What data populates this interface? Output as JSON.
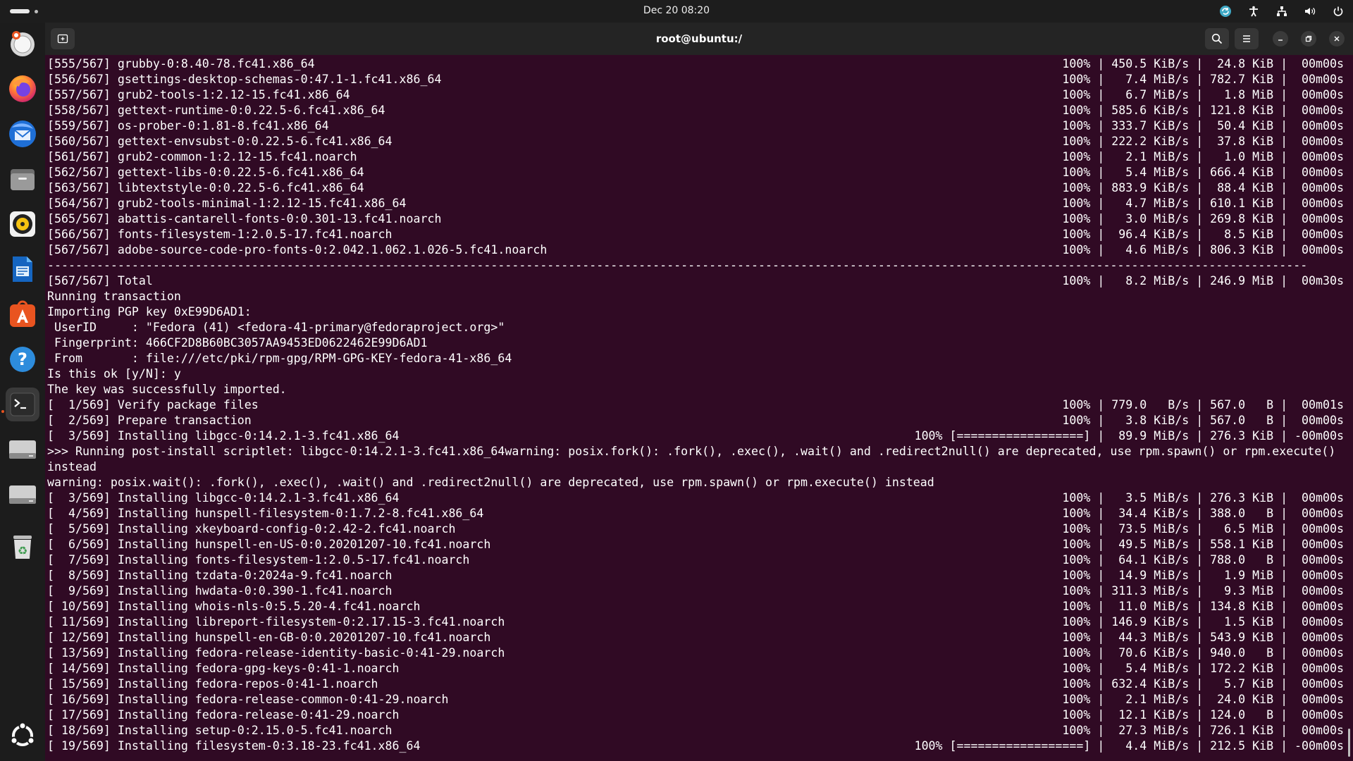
{
  "topbar": {
    "clock": "Dec 20  08:20",
    "tray_icons": [
      "updates-icon",
      "accessibility-icon",
      "network-icon",
      "volume-icon",
      "power-icon"
    ]
  },
  "dock": {
    "items": [
      "ubuntu-desktop-icon",
      "firefox-icon",
      "thunderbird-icon",
      "files-icon",
      "rhythmbox-icon",
      "writer-icon",
      "app-center-icon",
      "help-icon",
      "terminal-icon",
      "drive-icon",
      "drive-icon",
      "trash-icon"
    ],
    "show_apps": "show-apps-icon"
  },
  "window": {
    "title": "root@ubuntu:/",
    "bg": "#300a24"
  },
  "terminal": {
    "lines": [
      {
        "l": "[555/567] grubby-0:8.40-78.fc41.x86_64",
        "r": "100% | 450.5 KiB/s |  24.8 KiB |  00m00s"
      },
      {
        "l": "[556/567] gsettings-desktop-schemas-0:47.1-1.fc41.x86_64",
        "r": "100% |   7.4 MiB/s | 782.7 KiB |  00m00s"
      },
      {
        "l": "[557/567] grub2-tools-1:2.12-15.fc41.x86_64",
        "r": "100% |   6.7 MiB/s |   1.8 MiB |  00m00s"
      },
      {
        "l": "[558/567] gettext-runtime-0:0.22.5-6.fc41.x86_64",
        "r": "100% | 585.6 KiB/s | 121.8 KiB |  00m00s"
      },
      {
        "l": "[559/567] os-prober-0:1.81-8.fc41.x86_64",
        "r": "100% | 333.7 KiB/s |  50.4 KiB |  00m00s"
      },
      {
        "l": "[560/567] gettext-envsubst-0:0.22.5-6.fc41.x86_64",
        "r": "100% | 222.2 KiB/s |  37.8 KiB |  00m00s"
      },
      {
        "l": "[561/567] grub2-common-1:2.12-15.fc41.noarch",
        "r": "100% |   2.1 MiB/s |   1.0 MiB |  00m00s"
      },
      {
        "l": "[562/567] gettext-libs-0:0.22.5-6.fc41.x86_64",
        "r": "100% |   5.4 MiB/s | 666.4 KiB |  00m00s"
      },
      {
        "l": "[563/567] libtextstyle-0:0.22.5-6.fc41.x86_64",
        "r": "100% | 883.9 KiB/s |  88.4 KiB |  00m00s"
      },
      {
        "l": "[564/567] grub2-tools-minimal-1:2.12-15.fc41.x86_64",
        "r": "100% |   4.7 MiB/s | 610.1 KiB |  00m00s"
      },
      {
        "l": "[565/567] abattis-cantarell-fonts-0:0.301-13.fc41.noarch",
        "r": "100% |   3.0 MiB/s | 269.8 KiB |  00m00s"
      },
      {
        "l": "[566/567] fonts-filesystem-1:2.0.5-17.fc41.noarch",
        "r": "100% |  96.4 KiB/s |   8.5 KiB |  00m00s"
      },
      {
        "l": "[567/567] adobe-source-code-pro-fonts-0:2.042.1.062.1.026-5.fc41.noarch",
        "r": "100% |   4.6 MiB/s | 806.3 KiB |  00m00s"
      },
      {
        "l": "-----------------------------------------------------------------------------------------------------------------------------------------------------------------------------------",
        "r": ""
      },
      {
        "l": "[567/567] Total",
        "r": "100% |   8.2 MiB/s | 246.9 MiB |  00m30s"
      },
      {
        "l": "Running transaction",
        "r": ""
      },
      {
        "l": "Importing PGP key 0xE99D6AD1:",
        "r": ""
      },
      {
        "l": " UserID     : \"Fedora (41) <fedora-41-primary@fedoraproject.org>\"",
        "r": ""
      },
      {
        "l": " Fingerprint: 466CF2D8B60BC3057AA9453ED0622462E99D6AD1",
        "r": ""
      },
      {
        "l": " From       : file:///etc/pki/rpm-gpg/RPM-GPG-KEY-fedora-41-x86_64",
        "r": ""
      },
      {
        "l": "Is this ok [y/N]: y",
        "r": ""
      },
      {
        "l": "The key was successfully imported.",
        "r": ""
      },
      {
        "l": "[  1/569] Verify package files",
        "r": "100% | 779.0   B/s | 567.0   B |  00m01s"
      },
      {
        "l": "[  2/569] Prepare transaction",
        "r": "100% |   3.8 KiB/s | 567.0   B |  00m00s"
      },
      {
        "l": "[  3/569] Installing libgcc-0:14.2.1-3.fc41.x86_64",
        "r": "100% [==================] |  89.9 MiB/s | 276.3 KiB | -00m00s"
      },
      {
        "l": ">>> Running post-install scriptlet: libgcc-0:14.2.1-3.fc41.x86_64warning: posix.fork(): .fork(), .exec(), .wait() and .redirect2null() are deprecated, use rpm.spawn() or rpm.execute()",
        "r": ""
      },
      {
        "l": "instead",
        "r": ""
      },
      {
        "l": "warning: posix.wait(): .fork(), .exec(), .wait() and .redirect2null() are deprecated, use rpm.spawn() or rpm.execute() instead",
        "r": ""
      },
      {
        "l": "[  3/569] Installing libgcc-0:14.2.1-3.fc41.x86_64",
        "r": "100% |   3.5 MiB/s | 276.3 KiB |  00m00s"
      },
      {
        "l": "[  4/569] Installing hunspell-filesystem-0:1.7.2-8.fc41.x86_64",
        "r": "100% |  34.4 KiB/s | 388.0   B |  00m00s"
      },
      {
        "l": "[  5/569] Installing xkeyboard-config-0:2.42-2.fc41.noarch",
        "r": "100% |  73.5 MiB/s |   6.5 MiB |  00m00s"
      },
      {
        "l": "[  6/569] Installing hunspell-en-US-0:0.20201207-10.fc41.noarch",
        "r": "100% |  49.5 MiB/s | 558.1 KiB |  00m00s"
      },
      {
        "l": "[  7/569] Installing fonts-filesystem-1:2.0.5-17.fc41.noarch",
        "r": "100% |  64.1 KiB/s | 788.0   B |  00m00s"
      },
      {
        "l": "[  8/569] Installing tzdata-0:2024a-9.fc41.noarch",
        "r": "100% |  14.9 MiB/s |   1.9 MiB |  00m00s"
      },
      {
        "l": "[  9/569] Installing hwdata-0:0.390-1.fc41.noarch",
        "r": "100% | 311.3 MiB/s |   9.3 MiB |  00m00s"
      },
      {
        "l": "[ 10/569] Installing whois-nls-0:5.5.20-4.fc41.noarch",
        "r": "100% |  11.0 MiB/s | 134.8 KiB |  00m00s"
      },
      {
        "l": "[ 11/569] Installing libreport-filesystem-0:2.17.15-3.fc41.noarch",
        "r": "100% | 146.9 KiB/s |   1.5 KiB |  00m00s"
      },
      {
        "l": "[ 12/569] Installing hunspell-en-GB-0:0.20201207-10.fc41.noarch",
        "r": "100% |  44.3 MiB/s | 543.9 KiB |  00m00s"
      },
      {
        "l": "[ 13/569] Installing fedora-release-identity-basic-0:41-29.noarch",
        "r": "100% |  70.6 KiB/s | 940.0   B |  00m00s"
      },
      {
        "l": "[ 14/569] Installing fedora-gpg-keys-0:41-1.noarch",
        "r": "100% |   5.4 MiB/s | 172.2 KiB |  00m00s"
      },
      {
        "l": "[ 15/569] Installing fedora-repos-0:41-1.noarch",
        "r": "100% | 632.4 KiB/s |   5.7 KiB |  00m00s"
      },
      {
        "l": "[ 16/569] Installing fedora-release-common-0:41-29.noarch",
        "r": "100% |   2.1 MiB/s |  24.0 KiB |  00m00s"
      },
      {
        "l": "[ 17/569] Installing fedora-release-0:41-29.noarch",
        "r": "100% |  12.1 KiB/s | 124.0   B |  00m00s"
      },
      {
        "l": "[ 18/569] Installing setup-0:2.15.0-5.fc41.noarch",
        "r": "100% |  27.3 MiB/s | 726.1 KiB |  00m00s"
      },
      {
        "l": "[ 19/569] Installing filesystem-0:3.18-23.fc41.x86_64",
        "r": "100% [==================] |   4.4 MiB/s | 212.5 KiB | -00m00s"
      }
    ]
  }
}
